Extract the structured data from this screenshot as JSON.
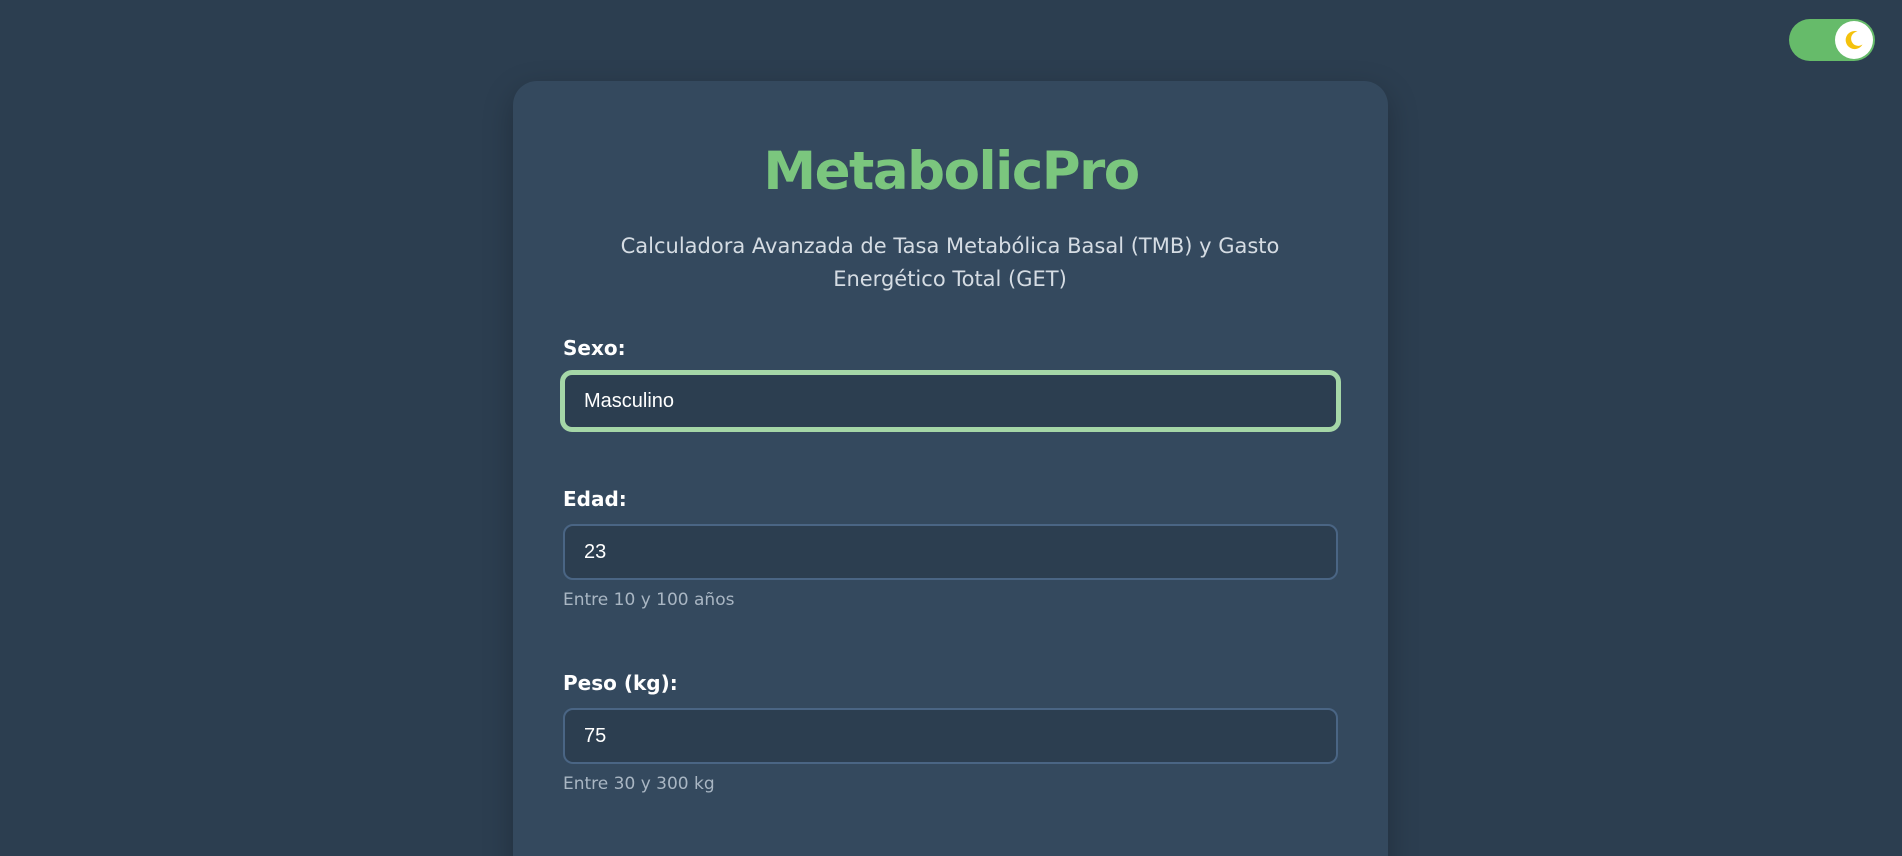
{
  "app": {
    "title": "MetabolicPro",
    "subtitle": "Calculadora Avanzada de Tasa Metabólica Basal (TMB) y Gasto Energético Total (GET)"
  },
  "theme_toggle": {
    "icon": "moon-icon",
    "state": "dark",
    "colors": {
      "track": "#66bb6a",
      "moon": "#f4c20d"
    }
  },
  "form": {
    "sexo": {
      "label": "Sexo:",
      "value": "Masculino"
    },
    "edad": {
      "label": "Edad:",
      "value": "23",
      "hint": "Entre 10 y 100 años"
    },
    "peso": {
      "label": "Peso (kg):",
      "value": "75",
      "hint": "Entre 30 y 300 kg"
    }
  },
  "colors": {
    "background": "#2c3e50",
    "card": "#34495e",
    "accent": "#7bc67e",
    "focus_border": "#a5d6a7"
  }
}
